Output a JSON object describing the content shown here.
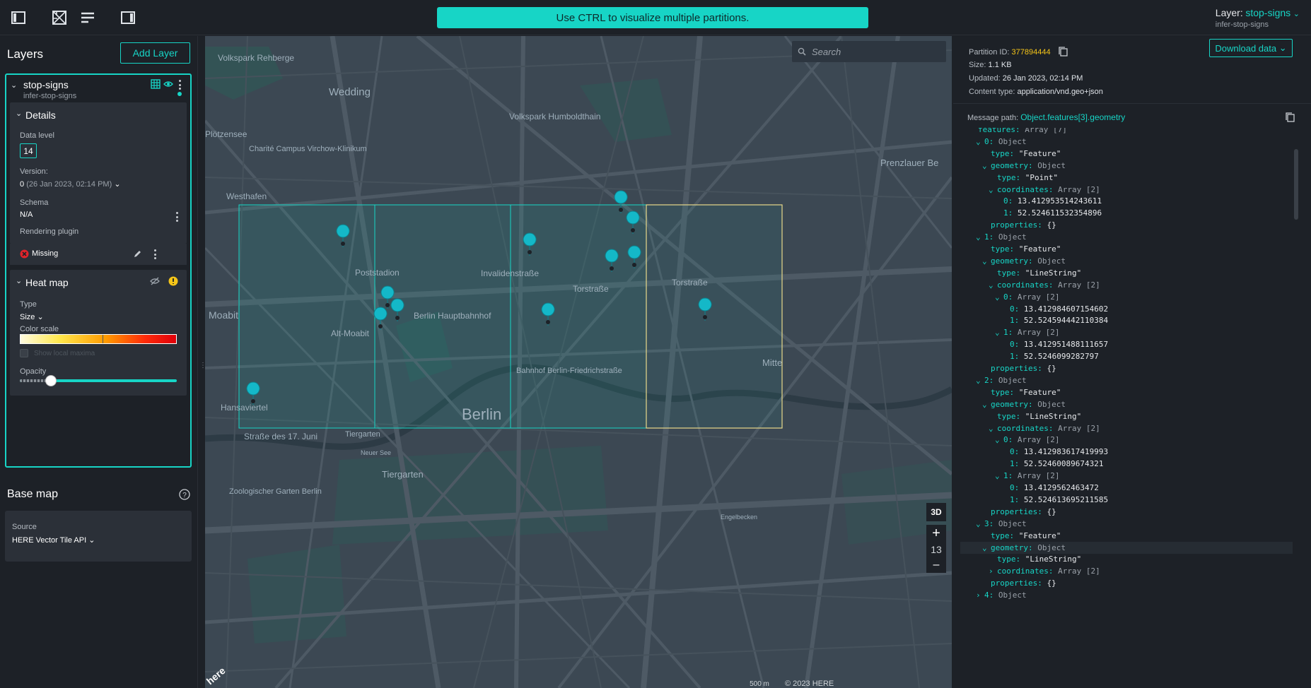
{
  "topbar": {
    "banner": "Use CTRL to visualize multiple partitions.",
    "layer_label": "Layer:",
    "layer_value": "stop-signs",
    "layer_sub": "infer-stop-signs"
  },
  "left": {
    "title": "Layers",
    "add_layer": "Add Layer",
    "layer": {
      "name": "stop-signs",
      "sub": "infer-stop-signs",
      "details_title": "Details",
      "data_level_label": "Data level",
      "data_level": "14",
      "version_label": "Version:",
      "version_value": "0",
      "version_date": "(26 Jan 2023, 02:14 PM)",
      "schema_label": "Schema",
      "schema_value": "N/A",
      "plugin_label": "Rendering plugin",
      "plugin_value": "Missing",
      "heatmap_title": "Heat map",
      "type_label": "Type",
      "type_value": "Size",
      "color_scale_label": "Color scale",
      "show_local_maxima": "Show local maxima",
      "opacity_label": "Opacity",
      "opacity_level": 0.2
    },
    "basemap": {
      "title": "Base map",
      "source_label": "Source",
      "source_value": "HERE Vector Tile API"
    }
  },
  "map": {
    "search_placeholder": "Search",
    "btn_3d": "3D",
    "zoom_level": "13",
    "zoom_in": "+",
    "zoom_out": "–",
    "scale": "500 m",
    "copyright": "© 2023 HERE",
    "here_logo": "here",
    "labels": {
      "volkspark_rehberge": "Volkspark Rehberge",
      "wedding": "Wedding",
      "volkspark_humboldthain": "Volkspark Humboldthain",
      "ploetzensee": "Plötzensee",
      "charite": "Charité Campus Virchow-Klinikum",
      "westhafen": "Westhafen",
      "prenzlauer": "Prenzlauer Be",
      "poststadion": "Poststadion",
      "berlin_hbf": "Berlin Hauptbahnhof",
      "moabit": "Moabit",
      "alt_moabit": "Alt-Moabit",
      "torstrasse": "Torstraße",
      "torstrasse2": "Torstraße",
      "invalidenstrasse": "Invalidenstraße",
      "bahnhof_fs": "Bahnhof Berlin-Friedrichstraße",
      "berlin": "Berlin",
      "mitte": "Mitte",
      "hansaviertel": "Hansaviertel",
      "strasse17juni": "Straße des 17. Juni",
      "tiergarten": "Tiergarten",
      "tiergarten2": "Tiergarten",
      "neuer_see": "Neuer See",
      "zoo": "Zoologischer Garten Berlin",
      "engelbecken": "Engelbecken"
    }
  },
  "right": {
    "partition_label": "Partition ID:",
    "partition_id": "377894444",
    "size_label": "Size:",
    "size_value": "1.1 KB",
    "updated_label": "Updated:",
    "updated_value": "26 Jan 2023, 02:14 PM",
    "content_label": "Content type:",
    "content_value": "application/vnd.geo+json",
    "download": "Download data",
    "message_path_label": "Message path:",
    "message_path": "Object.features[3].geometry"
  },
  "tree": [
    {
      "indent": 1,
      "caret": "",
      "key": "features:",
      "val": "Array [7]",
      "cls": "t"
    },
    {
      "indent": 2,
      "caret": "⌄",
      "key": "0:",
      "val": "Object",
      "cls": "t"
    },
    {
      "indent": 3,
      "caret": "",
      "key": "type:",
      "val": "\"Feature\"",
      "cls": "s"
    },
    {
      "indent": 3,
      "caret": "⌄",
      "key": "geometry:",
      "val": "Object",
      "cls": "t"
    },
    {
      "indent": 4,
      "caret": "",
      "key": "type:",
      "val": "\"Point\"",
      "cls": "s"
    },
    {
      "indent": 4,
      "caret": "⌄",
      "key": "coordinates:",
      "val": "Array [2]",
      "cls": "t"
    },
    {
      "indent": 5,
      "caret": "",
      "key": "0:",
      "val": "13.412953514243611",
      "cls": "n"
    },
    {
      "indent": 5,
      "caret": "",
      "key": "1:",
      "val": "52.524611532354896",
      "cls": "n"
    },
    {
      "indent": 3,
      "caret": "",
      "key": "properties:",
      "val": "{}",
      "cls": "s"
    },
    {
      "indent": 2,
      "caret": "⌄",
      "key": "1:",
      "val": "Object",
      "cls": "t"
    },
    {
      "indent": 3,
      "caret": "",
      "key": "type:",
      "val": "\"Feature\"",
      "cls": "s"
    },
    {
      "indent": 3,
      "caret": "⌄",
      "key": "geometry:",
      "val": "Object",
      "cls": "t"
    },
    {
      "indent": 4,
      "caret": "",
      "key": "type:",
      "val": "\"LineString\"",
      "cls": "s"
    },
    {
      "indent": 4,
      "caret": "⌄",
      "key": "coordinates:",
      "val": "Array [2]",
      "cls": "t"
    },
    {
      "indent": 5,
      "caret": "⌄",
      "key": "0:",
      "val": "Array [2]",
      "cls": "t"
    },
    {
      "indent": 6,
      "caret": "",
      "key": "0:",
      "val": "13.412984607154602",
      "cls": "n"
    },
    {
      "indent": 6,
      "caret": "",
      "key": "1:",
      "val": "52.524594442110384",
      "cls": "n"
    },
    {
      "indent": 5,
      "caret": "⌄",
      "key": "1:",
      "val": "Array [2]",
      "cls": "t"
    },
    {
      "indent": 6,
      "caret": "",
      "key": "0:",
      "val": "13.412951488111657",
      "cls": "n"
    },
    {
      "indent": 6,
      "caret": "",
      "key": "1:",
      "val": "52.5246099282797",
      "cls": "n"
    },
    {
      "indent": 3,
      "caret": "",
      "key": "properties:",
      "val": "{}",
      "cls": "s"
    },
    {
      "indent": 2,
      "caret": "⌄",
      "key": "2:",
      "val": "Object",
      "cls": "t"
    },
    {
      "indent": 3,
      "caret": "",
      "key": "type:",
      "val": "\"Feature\"",
      "cls": "s"
    },
    {
      "indent": 3,
      "caret": "⌄",
      "key": "geometry:",
      "val": "Object",
      "cls": "t"
    },
    {
      "indent": 4,
      "caret": "",
      "key": "type:",
      "val": "\"LineString\"",
      "cls": "s"
    },
    {
      "indent": 4,
      "caret": "⌄",
      "key": "coordinates:",
      "val": "Array [2]",
      "cls": "t"
    },
    {
      "indent": 5,
      "caret": "⌄",
      "key": "0:",
      "val": "Array [2]",
      "cls": "t"
    },
    {
      "indent": 6,
      "caret": "",
      "key": "0:",
      "val": "13.412983617419993",
      "cls": "n"
    },
    {
      "indent": 6,
      "caret": "",
      "key": "1:",
      "val": "52.52460089674321",
      "cls": "n"
    },
    {
      "indent": 5,
      "caret": "⌄",
      "key": "1:",
      "val": "Array [2]",
      "cls": "t"
    },
    {
      "indent": 6,
      "caret": "",
      "key": "0:",
      "val": "13.4129562463472",
      "cls": "n"
    },
    {
      "indent": 6,
      "caret": "",
      "key": "1:",
      "val": "52.524613695211585",
      "cls": "n"
    },
    {
      "indent": 3,
      "caret": "",
      "key": "properties:",
      "val": "{}",
      "cls": "s"
    },
    {
      "indent": 2,
      "caret": "⌄",
      "key": "3:",
      "val": "Object",
      "cls": "t"
    },
    {
      "indent": 3,
      "caret": "",
      "key": "type:",
      "val": "\"Feature\"",
      "cls": "s"
    },
    {
      "indent": 3,
      "caret": "⌄",
      "key": "geometry:",
      "val": "Object",
      "cls": "t",
      "highlight": true
    },
    {
      "indent": 4,
      "caret": "",
      "key": "type:",
      "val": "\"LineString\"",
      "cls": "s"
    },
    {
      "indent": 4,
      "caret": "›",
      "key": "coordinates:",
      "val": "Array [2]",
      "cls": "t"
    },
    {
      "indent": 3,
      "caret": "",
      "key": "properties:",
      "val": "{}",
      "cls": "s"
    },
    {
      "indent": 2,
      "caret": "›",
      "key": "4:",
      "val": "Object",
      "cls": "t"
    }
  ]
}
